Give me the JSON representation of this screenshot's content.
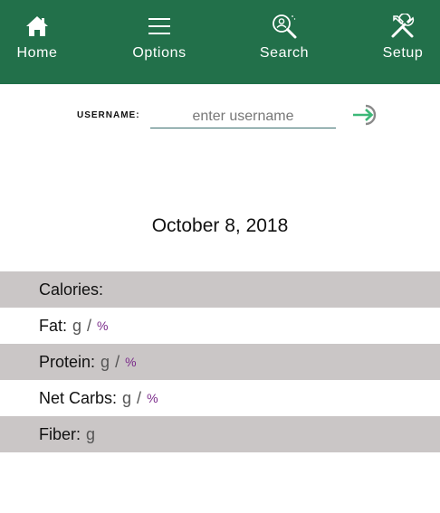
{
  "nav": {
    "items": [
      {
        "label": "Home",
        "icon": "home-icon"
      },
      {
        "label": "Options",
        "icon": "menu-icon"
      },
      {
        "label": "Search",
        "icon": "search-user-icon"
      },
      {
        "label": "Setup",
        "icon": "tools-icon"
      }
    ],
    "background": "#22704a"
  },
  "login": {
    "label": "USERNAME:",
    "placeholder": "enter username",
    "value": ""
  },
  "date": "October 8, 2018",
  "nutrition": {
    "calories_label": "Calories:",
    "fat_label": "Fat:",
    "protein_label": "Protein:",
    "carbs_label": "Net Carbs:",
    "fiber_label": "Fiber:",
    "gram_unit": "g",
    "separator": "/",
    "percent_unit": "%"
  },
  "colors": {
    "accent": "#22704a",
    "row_shade": "#cac6c6",
    "percent": "#7a2a8a",
    "login_arrow": "#3cb878"
  }
}
